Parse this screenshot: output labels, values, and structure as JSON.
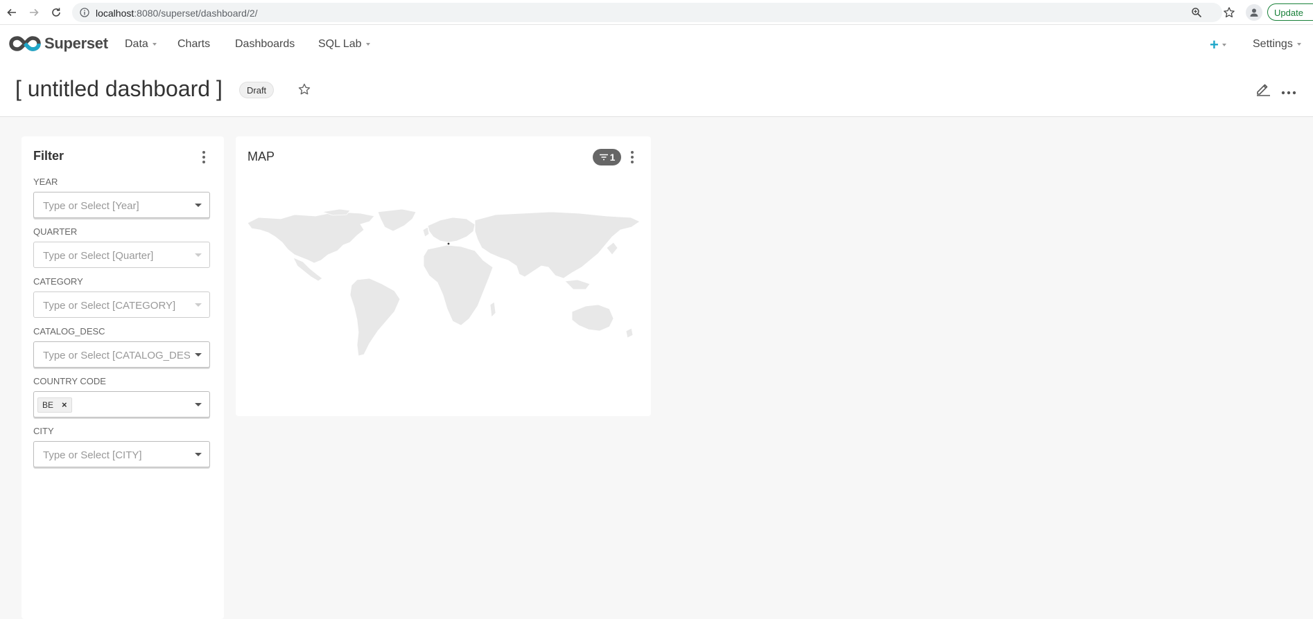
{
  "browser": {
    "url_host": "localhost",
    "url_rest": ":8080/superset/dashboard/2/",
    "update_label": "Update"
  },
  "nav": {
    "brand": "Superset",
    "items": [
      {
        "label": "Data",
        "dropdown": true
      },
      {
        "label": "Charts",
        "dropdown": false
      },
      {
        "label": "Dashboards",
        "dropdown": false
      },
      {
        "label": "SQL Lab",
        "dropdown": true
      }
    ],
    "plus_label": "+",
    "settings_label": "Settings"
  },
  "dashboard": {
    "title": "[ untitled dashboard ]",
    "status_badge": "Draft"
  },
  "filter": {
    "title": "Filter",
    "fields": [
      {
        "label": "YEAR",
        "placeholder": "Type or Select [Year]"
      },
      {
        "label": "QUARTER",
        "placeholder": "Type or Select [Quarter]"
      },
      {
        "label": "CATEGORY",
        "placeholder": "Type or Select [CATEGORY]"
      },
      {
        "label": "CATALOG_DESC",
        "placeholder": "Type or Select [CATALOG_DESC]"
      },
      {
        "label": "COUNTRY CODE",
        "selected_tag": "BE",
        "tag_remove": "×"
      },
      {
        "label": "CITY",
        "placeholder": "Type or Select [CITY]"
      }
    ]
  },
  "map_chart": {
    "title": "MAP",
    "filter_count": "1"
  },
  "colors": {
    "accent": "#20a7c9",
    "land": "#e8e8e8",
    "badge": "#666666",
    "update_green": "#188038"
  }
}
